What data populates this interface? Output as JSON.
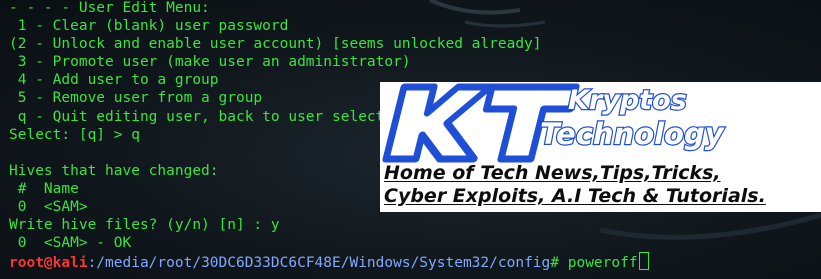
{
  "terminal": {
    "lines": [
      "- - - - User Edit Menu:",
      " 1 - Clear (blank) user password",
      "(2 - Unlock and enable user account) [seems unlocked already]",
      " 3 - Promote user (make user an administrator)",
      " 4 - Add user to a group",
      " 5 - Remove user from a group",
      " q - Quit editing user, back to user select",
      "Select: [q] > q",
      "",
      "Hives that have changed:",
      " #  Name",
      " 0  <SAM>",
      "Write hive files? (y/n) [n] : y",
      " 0  <SAM> - OK"
    ],
    "prompt": {
      "user_host": "root@kali",
      "path": ":/media/root/30DC6D33DC6CF48E/Windows/System32/config",
      "symbol": "# ",
      "command": "poweroff"
    },
    "colors": {
      "text": "#39e43c",
      "prompt_user": "#ff3333",
      "prompt_path": "#7fa8ff",
      "background": "#10171c"
    }
  },
  "watermark": {
    "logo_initials": "KT",
    "logo_word_1": "Kryptos",
    "logo_word_2": "Technology",
    "tagline_line_1": "Home of Tech News,Tips,Tricks,",
    "tagline_line_2": "Cyber Exploits, A.I Tech & Tutorials.",
    "colors": {
      "brand_blue": "#1f4fd6",
      "panel": "#ffffff",
      "tagline": "#0d0d0d"
    }
  }
}
